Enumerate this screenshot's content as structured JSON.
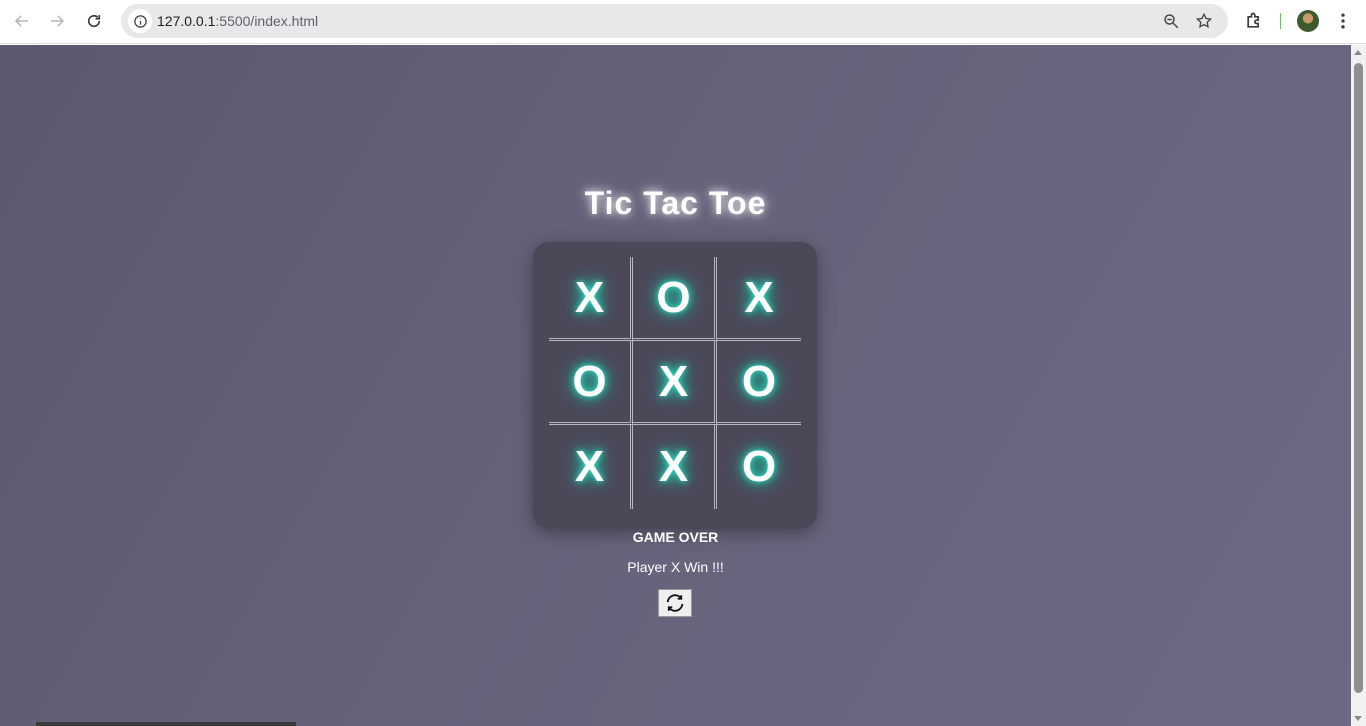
{
  "browser": {
    "url_host": "127.0.0.1",
    "url_rest": ":5500/index.html",
    "icons": [
      "back-arrow-icon",
      "forward-arrow-icon",
      "reload-icon",
      "site-info-icon",
      "zoom-icon",
      "bookmark-star-icon",
      "extensions-icon",
      "profile-avatar",
      "kebab-menu-icon"
    ]
  },
  "page": {
    "title": "Tic Tac Toe",
    "board": [
      [
        "X",
        "O",
        "X"
      ],
      [
        "O",
        "X",
        "O"
      ],
      [
        "X",
        "X",
        "O"
      ]
    ],
    "status_title": "GAME OVER",
    "status_message": "Player X Win !!!",
    "reset_icon": "refresh-icon"
  },
  "colors": {
    "background": "#66627a",
    "board": "#4c4858",
    "mark_glow": "#2fe0c4"
  }
}
